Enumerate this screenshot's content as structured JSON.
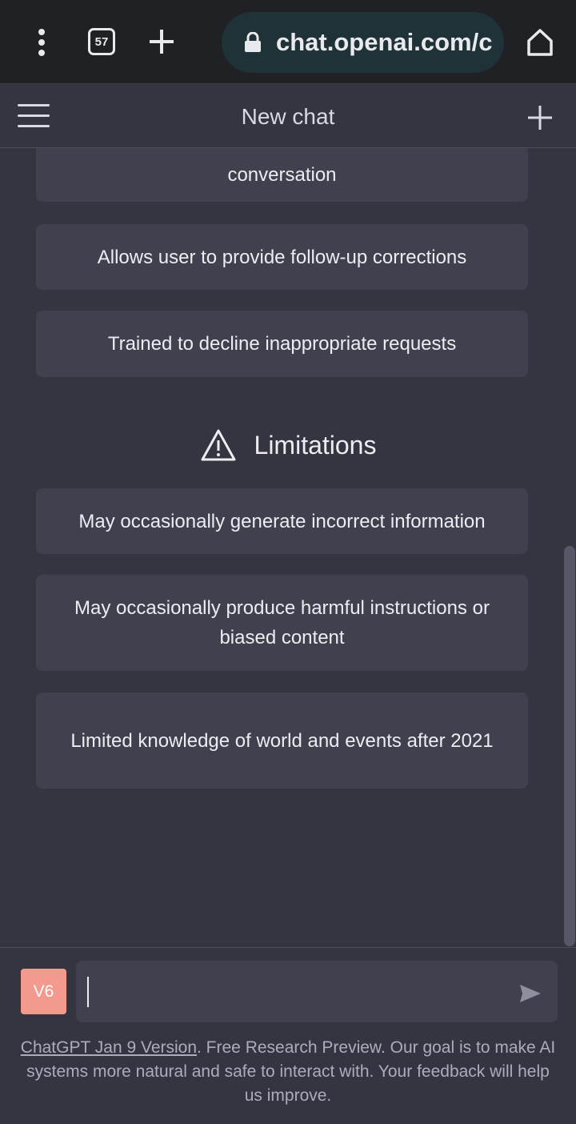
{
  "browser": {
    "tab_count": "57",
    "url": "chat.openai.com/c"
  },
  "header": {
    "title": "New chat"
  },
  "capabilities": [
    "conversation",
    "Allows user to provide follow-up corrections",
    "Trained to decline inappropriate requests"
  ],
  "limitations": {
    "heading": "Limitations",
    "items": [
      "May occasionally generate incorrect information",
      "May occasionally produce harmful instructions or biased content",
      "Limited knowledge of world and events after 2021"
    ]
  },
  "composer": {
    "avatar_initials": "V6",
    "input_value": ""
  },
  "footer": {
    "version_link": "ChatGPT Jan 9 Version",
    "text": ". Free Research Preview. Our goal is to make AI systems more natural and safe to interact with. Your feedback will help us improve."
  },
  "colors": {
    "background": "#343541",
    "card": "#40414f",
    "avatar": "#f4998d",
    "browser_bar": "#202124",
    "url_pill": "#1f3238"
  }
}
